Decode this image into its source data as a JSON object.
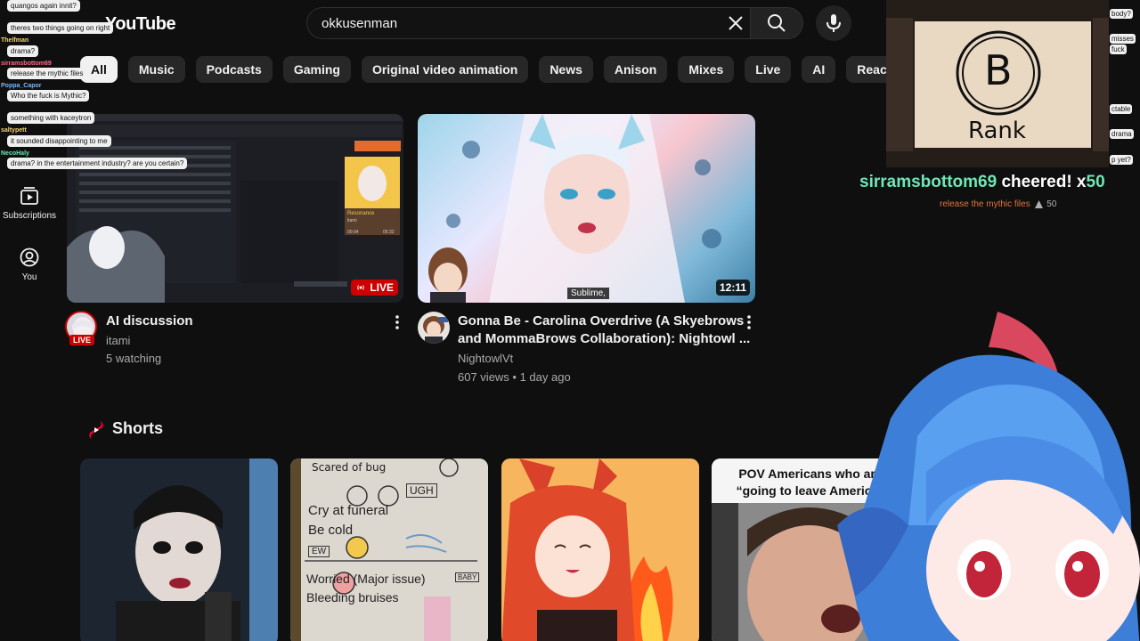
{
  "header": {
    "logo_text": "YouTube",
    "search_value": "okkusenman"
  },
  "chips": [
    "All",
    "Music",
    "Podcasts",
    "Gaming",
    "Original video animation",
    "News",
    "Anison",
    "Mixes",
    "Live",
    "AI",
    "Reaction videos"
  ],
  "sidebar": {
    "subscriptions": "Subscriptions",
    "you": "You"
  },
  "videos": [
    {
      "title": "AI discussion",
      "channel": "itami",
      "meta": "5 watching",
      "badge": "LIVE",
      "avatar_badge": "LIVE"
    },
    {
      "title_line1": "Gonna Be - Carolina Overdrive (A Skyebrows",
      "title_line2": "and MommaBrows Collaboration): Nightowl ...",
      "channel": "NightowlVt",
      "views": "607 views",
      "age": "1 day ago",
      "duration": "12:11",
      "caption": "Sublime,"
    }
  ],
  "thumb1_ui": {
    "track_name": "Resonance",
    "track_artist": "itami",
    "time_left": "00:04",
    "time_right": "05:32"
  },
  "shorts": {
    "title": "Shorts",
    "items": [
      {
        "text": ""
      },
      {
        "lines": [
          "Scared of bug",
          "UGH",
          "Cry at funeral",
          "Be cold",
          "EW",
          "Worried (Major issue)",
          "Bleeding bruises",
          "BABY"
        ]
      },
      {
        "text": ""
      },
      {
        "caption_line1": "POV Americans who are",
        "caption_line2": "“going to leave America”"
      }
    ]
  },
  "chat_overlay": [
    {
      "name": "",
      "msg": "quangos again innit?"
    },
    {
      "name": "",
      "msg": "theres two things going on right"
    },
    {
      "name": "Thelfman",
      "msg": "drama?"
    },
    {
      "name": "sirramsbottom69",
      "msg": "release the mythic files"
    },
    {
      "name": "Poppa_Capor",
      "msg": "Who the fuck is Mythic?"
    },
    {
      "name": "",
      "msg": "something with kaceytron"
    },
    {
      "name": "saltypett",
      "msg": "it sounded disappointing to me"
    },
    {
      "name": "NecoHaly",
      "msg": "drama? in the entertainment industry? are you certain?"
    }
  ],
  "right_chat": [
    "body?",
    "misses",
    "fuck",
    "ctable",
    "drama",
    "p yet?"
  ],
  "stream": {
    "rank_letter": "B",
    "rank_word": "Rank",
    "cheer_name": "sirramsbottom69",
    "cheer_text": "cheered! x",
    "cheer_amount": "50",
    "cheer_message": "release the mythic files",
    "cheer_message_amount": "50"
  },
  "colors": {
    "background": "#0f0f0f",
    "chip_bg": "#272727",
    "live_red": "#cc0000",
    "cheer_green": "#6ee7b7"
  }
}
